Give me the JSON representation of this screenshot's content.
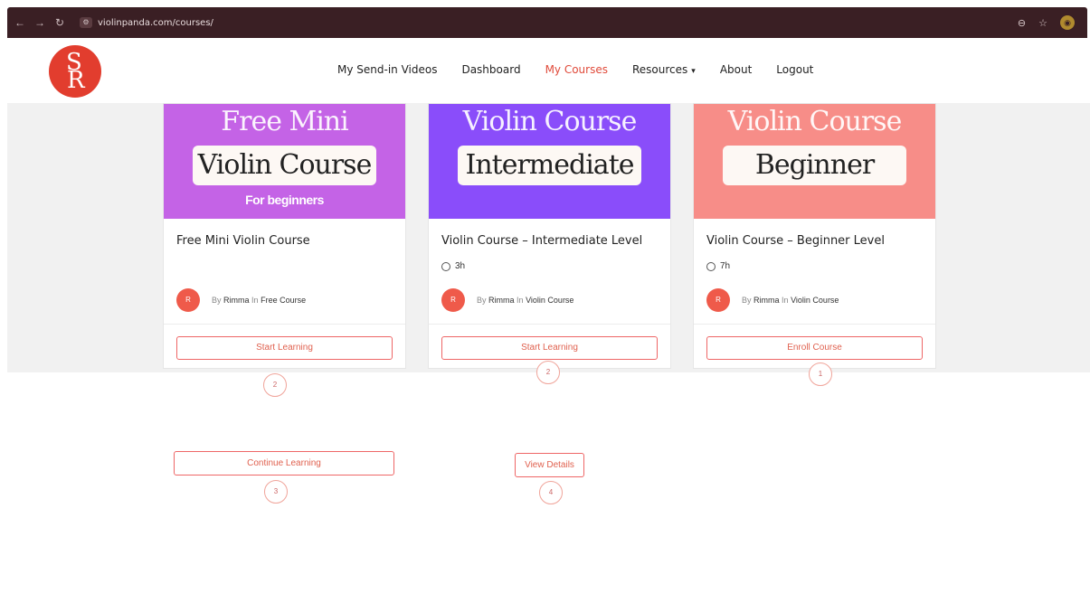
{
  "browser": {
    "url": "violinpanda.com/courses/",
    "nav_back": "←",
    "nav_forward": "→",
    "nav_reload": "↻",
    "site_icon": "⚙",
    "key_icon": "⊖",
    "star_icon": "☆",
    "profile_initial": "◉"
  },
  "header": {
    "logo": {
      "letter_top": "S",
      "letter_bottom": "R"
    },
    "nav": [
      {
        "label": "My Send-in Videos"
      },
      {
        "label": "Dashboard"
      },
      {
        "label": "My Courses",
        "active": true
      },
      {
        "label": "Resources"
      },
      {
        "label": "About"
      },
      {
        "label": "Logout"
      }
    ],
    "dropdown_caret": "▾"
  },
  "courses": [
    {
      "banner_color": "#c463e6",
      "banner_top": "Free Mini",
      "banner_pill": "Violin Course",
      "banner_sub": "For beginners",
      "title": "Free Mini Violin Course",
      "duration": "",
      "author_initial": "R",
      "by": "By",
      "author": "Rimma",
      "in": "In",
      "category": "Free Course",
      "cta": "Start Learning"
    },
    {
      "banner_color": "#8a4dfa",
      "banner_top": "Violin Course",
      "banner_pill": "Intermediate",
      "banner_sub": "",
      "title": "Violin Course – Intermediate Level",
      "duration": "3h",
      "author_initial": "R",
      "by": "By",
      "author": "Rimma",
      "in": "In",
      "category": "Violin Course",
      "cta": "Start Learning"
    },
    {
      "banner_color": "#f78d88",
      "banner_top": "Violin Course",
      "banner_pill": "Beginner",
      "banner_sub": "",
      "title": "Violin Course – Beginner Level",
      "duration": "7h",
      "author_initial": "R",
      "by": "By",
      "author": "Rimma",
      "in": "In",
      "category": "Violin Course",
      "cta": "Enroll Course"
    }
  ],
  "markers": [
    "2",
    "2",
    "1",
    "3",
    "4"
  ],
  "extra_buttons": {
    "continue": "Continue Learning",
    "view_details": "View Details"
  }
}
